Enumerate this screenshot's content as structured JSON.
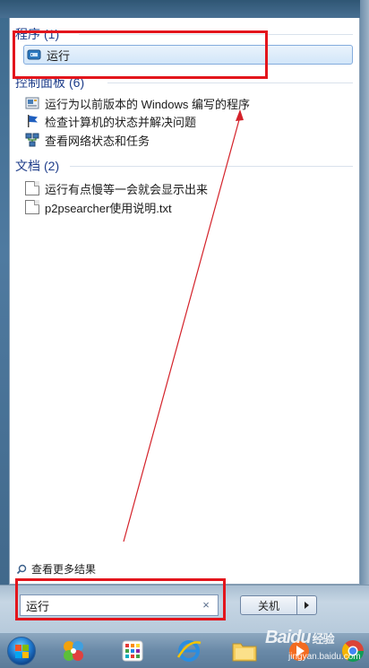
{
  "search_results": {
    "groups": [
      {
        "title": "程序",
        "count": "(1)",
        "items": [
          {
            "label": "运行",
            "icon": "run-dialog-icon",
            "selected": true
          }
        ]
      },
      {
        "title": "控制面板",
        "count": "(6)",
        "items": [
          {
            "label": "运行为以前版本的 Windows 编写的程序",
            "icon": "compatibility-icon"
          },
          {
            "label": "检查计算机的状态并解决问题",
            "icon": "action-center-flag-icon"
          },
          {
            "label": "查看网络状态和任务",
            "icon": "network-icon"
          }
        ]
      },
      {
        "title": "文档",
        "count": "(2)",
        "items": [
          {
            "label": "运行有点慢等一会就会显示出来",
            "icon": "text-document-icon"
          },
          {
            "label": "p2psearcher使用说明.txt",
            "icon": "text-document-icon"
          }
        ]
      }
    ],
    "see_more": "查看更多结果"
  },
  "search": {
    "value": "运行",
    "clear_icon": "×"
  },
  "shutdown": {
    "label": "关机"
  },
  "taskbar": {
    "apps": [
      "start-orb",
      "pinwheel-app-icon",
      "colorful-grid-app-icon",
      "internet-explorer-icon",
      "file-explorer-icon",
      "media-player-icon",
      "chrome-icon"
    ]
  },
  "watermark": {
    "brand": "Bai",
    "brand_paw": "du",
    "brand_sub": "经验",
    "url": "jingyan.baidu.com"
  },
  "colors": {
    "annotation_red": "#e3151c",
    "group_header_blue": "#1e3d8a",
    "selection_border": "#84acdd"
  }
}
